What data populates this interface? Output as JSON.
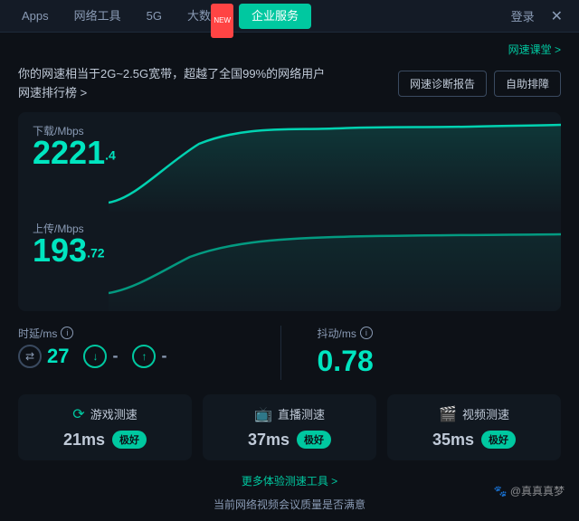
{
  "nav": {
    "items": [
      {
        "label": "Apps",
        "active": false,
        "badge": false,
        "id": "apps"
      },
      {
        "label": "网络工具",
        "active": false,
        "badge": false,
        "id": "network-tools"
      },
      {
        "label": "5G",
        "active": false,
        "badge": false,
        "id": "5g"
      },
      {
        "label": "大数据",
        "active": false,
        "badge": true,
        "badge_text": "NEW",
        "id": "bigdata"
      },
      {
        "label": "企业服务",
        "active": true,
        "badge": false,
        "id": "enterprise"
      },
      {
        "label": "登录",
        "active": false,
        "badge": false,
        "id": "login"
      }
    ],
    "close_label": "✕"
  },
  "header": {
    "link_text": "网速课堂 >"
  },
  "info": {
    "description": "你的网速相当于2G~2.5G宽带，超越了全国99%的网络用户",
    "rank_link": "网速排行榜 >",
    "buttons": [
      {
        "label": "网速诊断报告",
        "id": "diagnosis"
      },
      {
        "label": "自助排障",
        "id": "selfhelp"
      }
    ]
  },
  "download": {
    "label": "下载/Mbps",
    "value": "2221",
    "decimal": ".4"
  },
  "upload": {
    "label": "上传/Mbps",
    "value": "193",
    "decimal": ".72"
  },
  "latency": {
    "label": "时延/ms",
    "value": "27",
    "down_value": "-",
    "up_value": "-"
  },
  "jitter": {
    "label": "抖动/ms",
    "value": "0.78"
  },
  "speed_cards": [
    {
      "id": "game",
      "icon": "⟳",
      "title": "游戏测速",
      "ms": "21ms",
      "badge": "极好"
    },
    {
      "id": "live",
      "icon": "📺",
      "title": "直播测速",
      "ms": "37ms",
      "badge": "极好"
    },
    {
      "id": "video",
      "icon": "🎬",
      "title": "视频测速",
      "ms": "35ms",
      "badge": "极好"
    }
  ],
  "bottom": {
    "more_link": "更多体验测速工具 >",
    "survey_text": "当前网络视频会议质量是否满意"
  },
  "watermark": "@真真真梦"
}
